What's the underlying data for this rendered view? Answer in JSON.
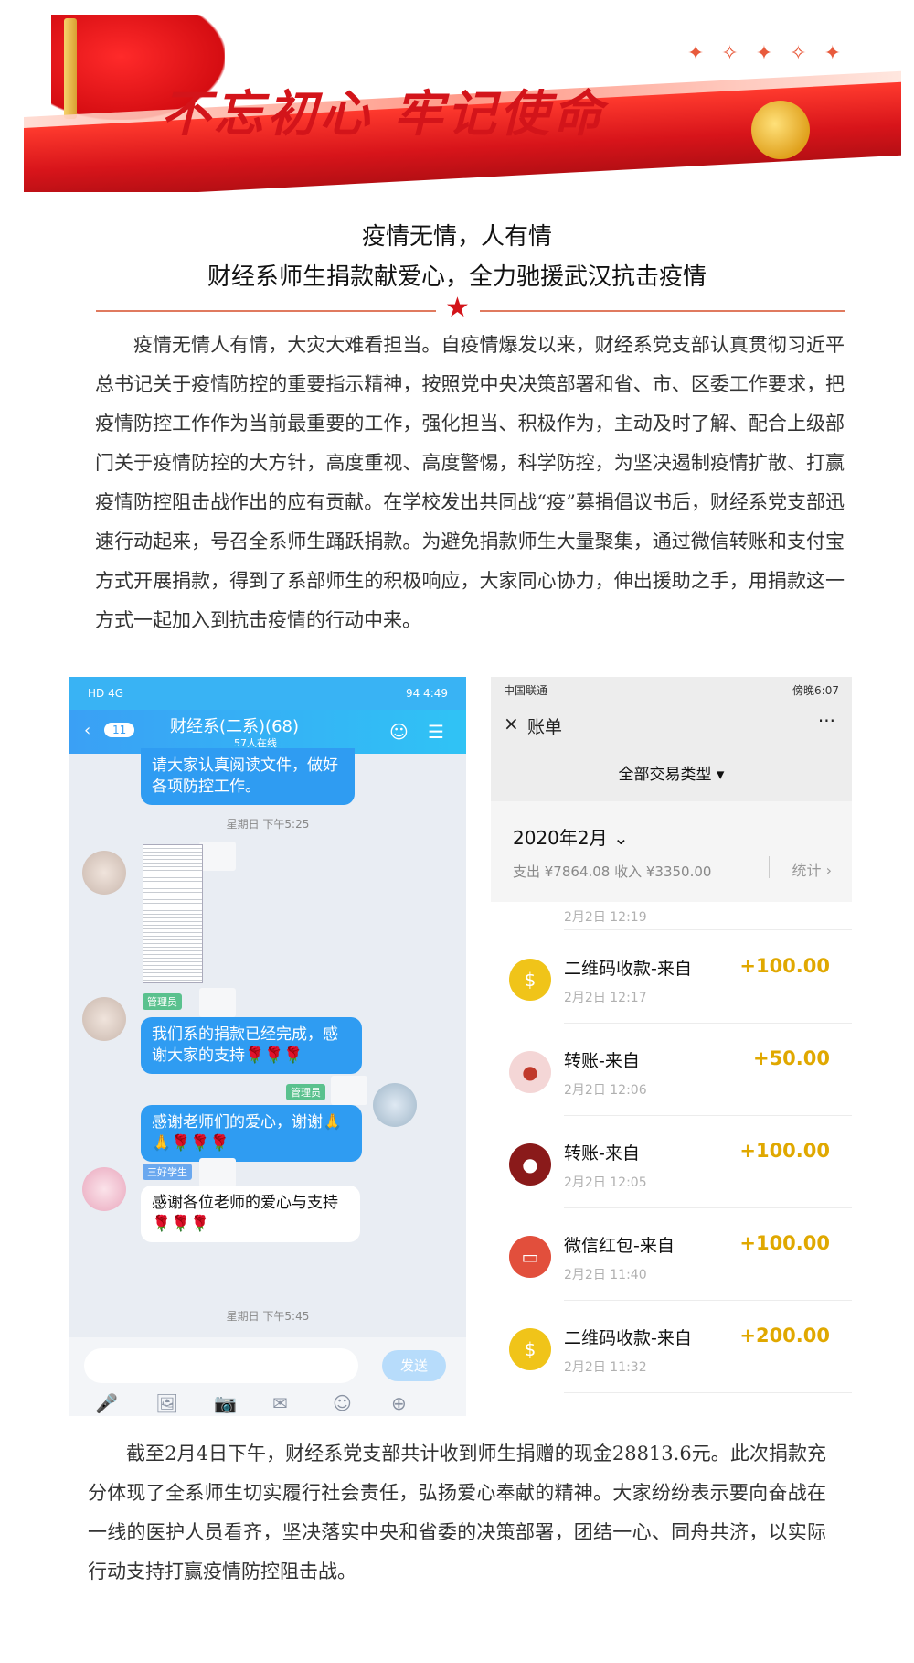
{
  "banner": {
    "slogan": "不忘初心 牢记使命"
  },
  "title": {
    "line1": "疫情无情，人有情",
    "line2": "财经系师生捐款献爱心，全力驰援武汉抗击疫情"
  },
  "divider_star": "★",
  "para1": "疫情无情人有情，大灾大难看担当。自疫情爆发以来，财经系党支部认真贯彻习近平总书记关于疫情防控的重要指示精神，按照党中央决策部署和省、市、区委工作要求，把疫情防控工作作为当前最重要的工作，强化担当、积极作为，主动及时了解、配合上级部门关于疫情防控的大方针，高度重视、高度警惕，科学防控，为坚决遏制疫情扩散、打赢疫情防控阻击战作出的应有贡献。在学校发出共同战“疫”募捐倡议书后，财经系党支部迅速行动起来，号召全系师生踊跃捐款。为避免捐款师生大量聚集，通过微信转账和支付宝方式开展捐款，得到了系部师生的积极响应，大家同心协力，伸出援助之手，用捐款这一方式一起加入到抗击疫情的行动中来。",
  "para2": "截至2月4日下午，财经系党支部共计收到师生捐赠的现金28813.6元。此次捐款充分体现了全系师生切实履行社会责任，弘扬爱心奉献的精神。大家纷纷表示要向奋战在一线的医护人员看齐，坚决落实中央和省委的决策部署，团结一心、同舟共济，以实际行动支持打赢疫情防控阻击战。",
  "chat": {
    "status_left": "HD 4G",
    "status_right": "94 4:49",
    "back_badge": "11",
    "group_title": "财经系(二系)(68)",
    "online": "57人在线",
    "msg1": "请大家认真阅读文件，做好各项防控工作。",
    "time1": "星期日 下午5:25",
    "tag_admin": "管理员",
    "tag_student": "三好学生",
    "msg2": "我们系的捐款已经完成，感谢大家的支持🌹🌹🌹",
    "msg3": "感谢老师们的爱心，谢谢🙏🙏🌹🌹🌹",
    "msg4": "感谢各位老师的爱心与支持🌹🌹🌹",
    "time2": "星期日 下午5:45",
    "send": "发送"
  },
  "bill": {
    "status_left": "中国联通",
    "status_right": "傍晚6:07",
    "close": "×",
    "title": "账单",
    "more": "···",
    "filter": "全部交易类型 ▾",
    "month": "2020年2月 ⌄",
    "summary": "支出 ¥7864.08 收入 ¥3350.00",
    "stat": "统计 ›",
    "top_date": "2月2日 12:19",
    "transactions": [
      {
        "name": "二维码收款-来自",
        "date": "2月2日 12:17",
        "amount": "+100.00",
        "icon": "money-bag-icon",
        "color": "#f0c419"
      },
      {
        "name": "转账-来自",
        "date": "2月2日 12:06",
        "amount": "+50.00",
        "icon": "avatar-doll",
        "color": "#f4d6d6"
      },
      {
        "name": "转账-来自",
        "date": "2月2日 12:05",
        "amount": "+100.00",
        "icon": "avatar-cat",
        "color": "#8a1a1a"
      },
      {
        "name": "微信红包-来自",
        "date": "2月2日 11:40",
        "amount": "+100.00",
        "icon": "red-packet-icon",
        "color": "#e24f3c"
      },
      {
        "name": "二维码收款-来自",
        "date": "2月2日 11:32",
        "amount": "+200.00",
        "icon": "money-bag-icon",
        "color": "#f0c419"
      }
    ]
  }
}
